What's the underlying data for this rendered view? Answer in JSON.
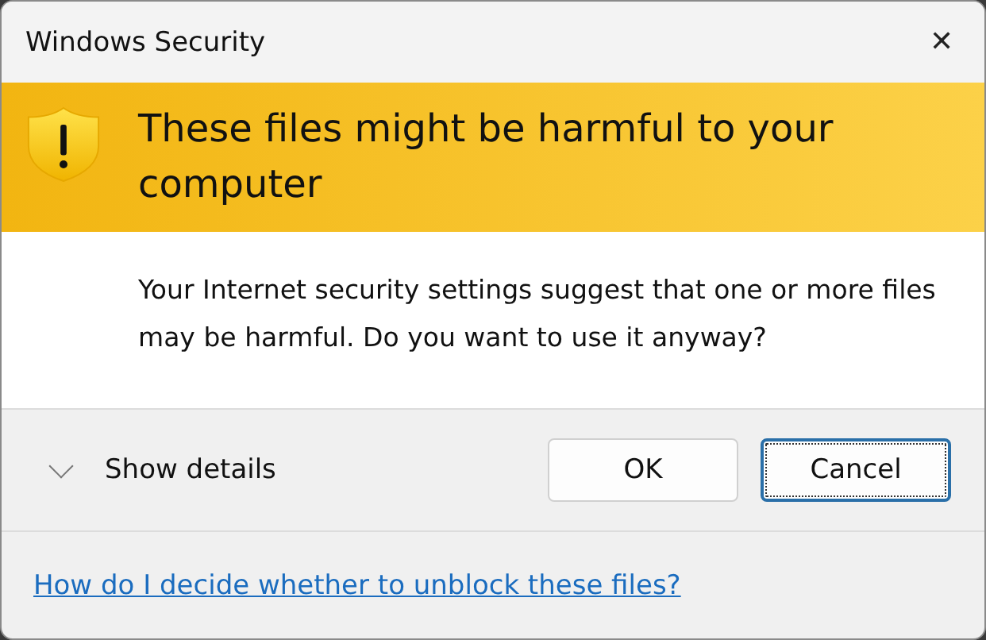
{
  "window": {
    "title": "Windows Security",
    "close": "✕"
  },
  "banner": {
    "heading": "These files might be harmful to your computer"
  },
  "message": "Your Internet security settings suggest that one or more files may be harmful. Do you want to use it anyway?",
  "details": {
    "label": "Show details",
    "expanded": false
  },
  "buttons": [
    {
      "label": "OK",
      "focused": false
    },
    {
      "label": "Cancel",
      "focused": true
    }
  ],
  "help_link": "How do I decide whether to unblock these files?"
}
